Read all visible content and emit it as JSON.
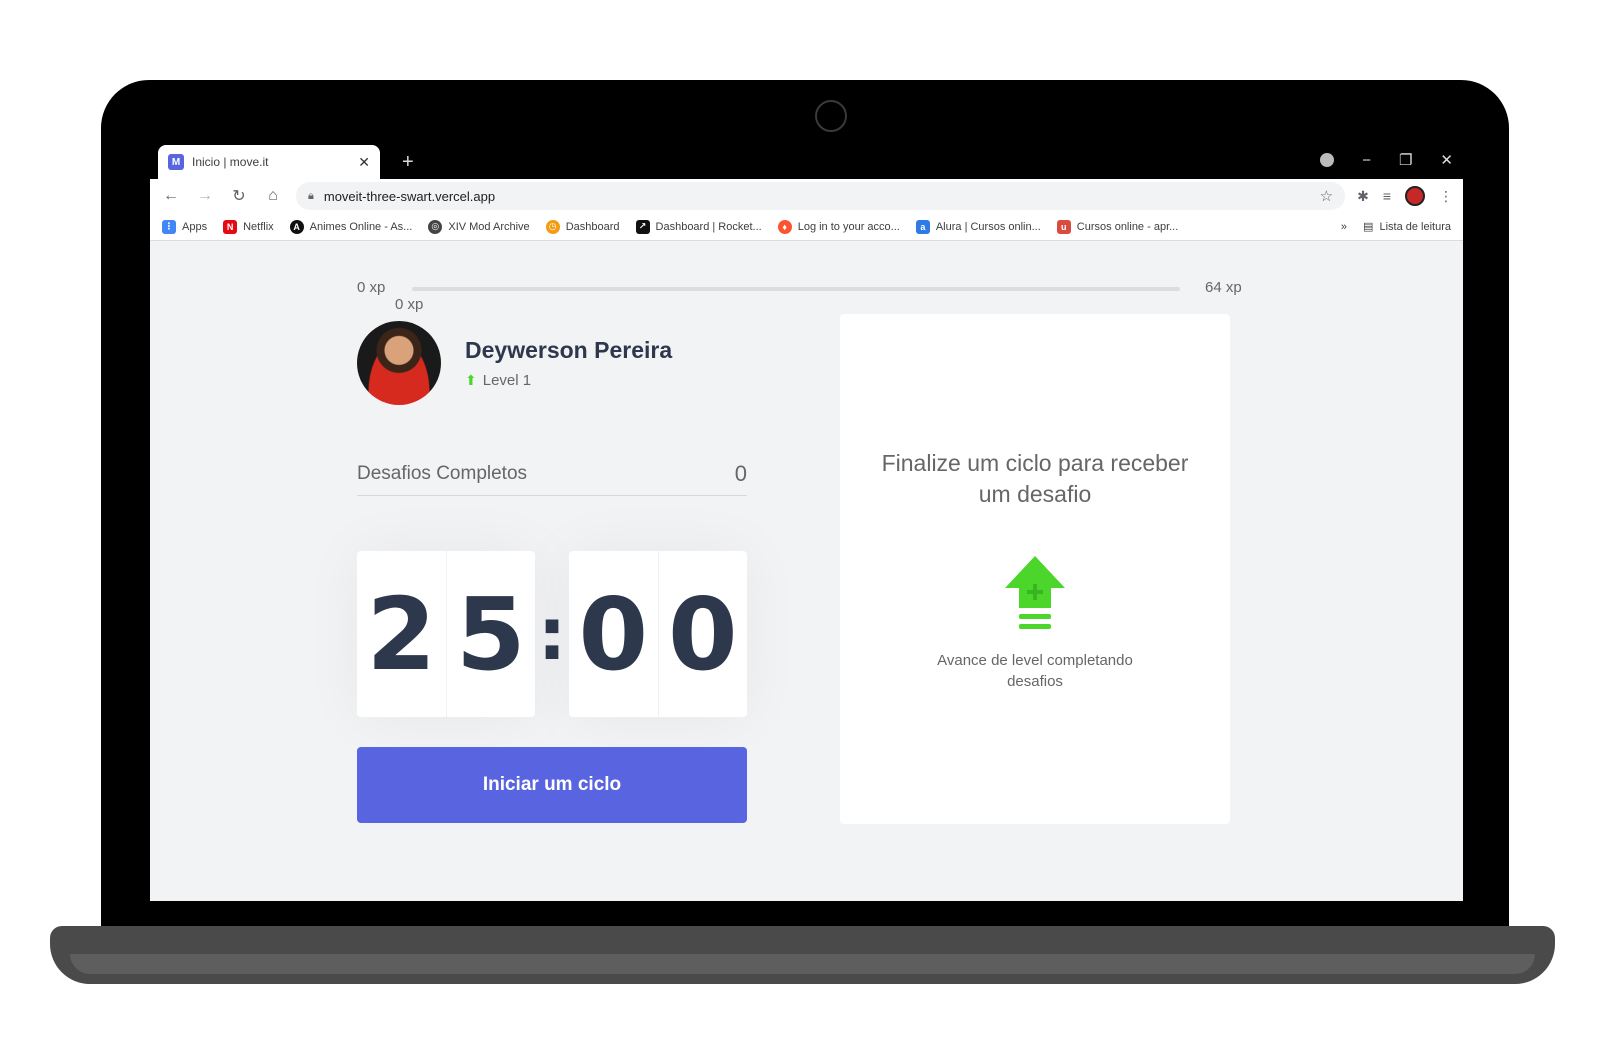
{
  "browser": {
    "tab_title": "Inicio | move.it",
    "tab_favicon": "M",
    "new_tab": "+",
    "url": "moveit-three-swart.vercel.app",
    "bookmarks": [
      {
        "label": "Apps",
        "color": "#4285f4",
        "glyph": "⋮"
      },
      {
        "label": "Netflix",
        "color": "#e50914",
        "glyph": "N"
      },
      {
        "label": "Animes Online - As...",
        "color": "#111111",
        "glyph": "A"
      },
      {
        "label": "XIV Mod Archive",
        "color": "#444444",
        "glyph": "◎"
      },
      {
        "label": "Dashboard",
        "color": "#f39c12",
        "glyph": "◷"
      },
      {
        "label": "Dashboard | Rocket...",
        "color": "#111111",
        "glyph": "↗"
      },
      {
        "label": "Log in to your acco...",
        "color": "#fc5430",
        "glyph": "♦"
      },
      {
        "label": "Alura | Cursos onlin...",
        "color": "#2f7be5",
        "glyph": "a"
      },
      {
        "label": "Cursos online - apr...",
        "color": "#d84b3f",
        "glyph": "u"
      }
    ],
    "overflow": "»",
    "reading_list": "Lista de leitura"
  },
  "xp": {
    "start": "0 xp",
    "end": "64 xp",
    "current": "0 xp",
    "progress_fraction": 0
  },
  "profile": {
    "name": "Deywerson Pereira",
    "level": "Level 1"
  },
  "completed": {
    "label": "Desafios Completos",
    "count": "0"
  },
  "countdown": {
    "minute_left": "2",
    "minute_right": "5",
    "separator": ":",
    "second_left": "0",
    "second_right": "0"
  },
  "start_button": "Iniciar um ciclo",
  "challenge": {
    "title": "Finalize um ciclo para receber um desafio",
    "text": "Avance de level completando desafios"
  },
  "colors": {
    "primary": "#5965e0",
    "green": "#4cd62b",
    "title": "#2e384d",
    "text": "#666666"
  }
}
